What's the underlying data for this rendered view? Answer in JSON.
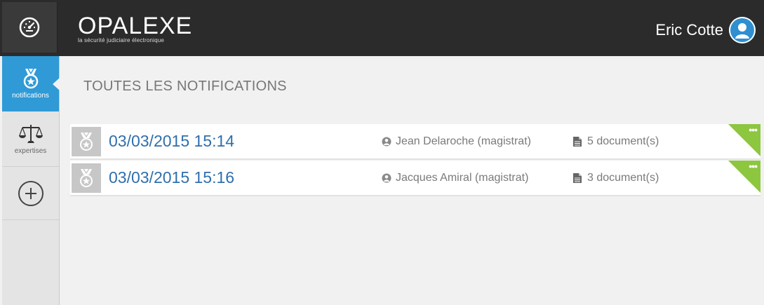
{
  "app": {
    "brand_name": "OPALEXE",
    "brand_tagline": "la sécurité judiciaire électronique",
    "dashboard_icon": "speedometer-icon"
  },
  "user": {
    "name": "Eric Cotte",
    "avatar_icon": "user-avatar-icon"
  },
  "sidebar": {
    "items": [
      {
        "label": "notifications",
        "icon": "medal-icon",
        "active": true
      },
      {
        "label": "expertises",
        "icon": "scales-icon",
        "active": false
      },
      {
        "label": "",
        "icon": "plus-circle-icon",
        "active": false
      }
    ]
  },
  "main": {
    "title": "TOUTES LES NOTIFICATIONS",
    "notifications": [
      {
        "date": "03/03/2015 15:14",
        "author": "Jean Delaroche (magistrat)",
        "documents": "5 document(s)",
        "menu": "•••"
      },
      {
        "date": "03/03/2015 15:16",
        "author": "Jacques Amiral (magistrat)",
        "documents": "3 document(s)",
        "menu": "•••"
      }
    ]
  },
  "colors": {
    "topbar": "#2b2b2b",
    "active_nav": "#2f9ad6",
    "date_link": "#2f6fad",
    "corner_badge": "#8dc63f"
  }
}
